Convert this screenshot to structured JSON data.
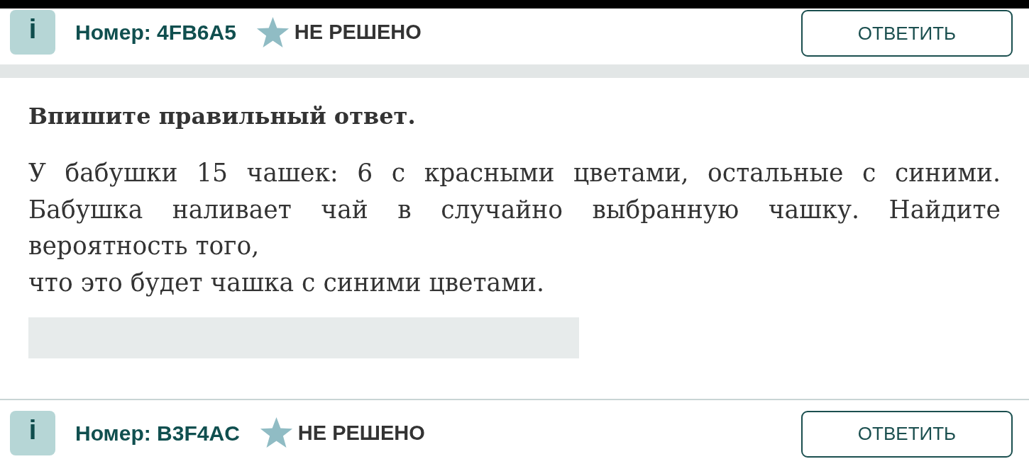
{
  "tasks": [
    {
      "info_badge": "i",
      "number": "Номер: 4FB6A5",
      "status": "НЕ РЕШЕНО",
      "answer_button": "ОТВЕТИТЬ",
      "instruction": "Впишите правильный ответ.",
      "question": [
        "У бабушки 15 чашек: 6 с красными цветами, остальные с синими. Бабушка наливает чай в случайно выбранную чашку. Найдите вероятность того,",
        "что это будет чашка с синими цветами."
      ]
    },
    {
      "info_badge": "i",
      "number": "Номер: B3F4AC",
      "status": "НЕ РЕШЕНО",
      "answer_button": "ОТВЕТИТЬ"
    }
  ]
}
